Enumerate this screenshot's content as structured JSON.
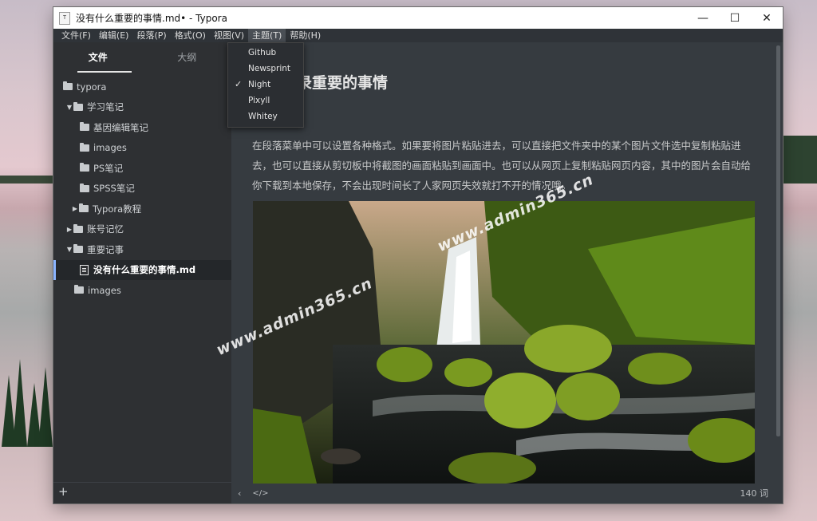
{
  "window": {
    "title": "没有什么重要的事情.md• - Typora",
    "app_icon_text": "T",
    "controls": {
      "minimize": "—",
      "maximize": "☐",
      "close": "✕"
    }
  },
  "menubar": {
    "items": [
      "文件(F)",
      "编辑(E)",
      "段落(P)",
      "格式(O)",
      "视图(V)",
      "主题(T)",
      "帮助(H)"
    ]
  },
  "theme_menu": {
    "items": [
      "Github",
      "Newsprint",
      "Night",
      "Pixyll",
      "Whitey"
    ],
    "checked": "Night",
    "check_glyph": "✓"
  },
  "sidebar": {
    "tabs": [
      "文件",
      "大纲"
    ],
    "active_tab": "文件",
    "tree": [
      {
        "label": "typora",
        "type": "folder",
        "caret": ""
      },
      {
        "label": "学习笔记",
        "type": "folder",
        "caret": "▼"
      },
      {
        "label": "基因编辑笔记",
        "type": "folder",
        "caret": ""
      },
      {
        "label": "images",
        "type": "folder",
        "caret": ""
      },
      {
        "label": "PS笔记",
        "type": "folder",
        "caret": ""
      },
      {
        "label": "SPSS笔记",
        "type": "folder",
        "caret": ""
      },
      {
        "label": "Typora教程",
        "type": "folder",
        "caret": "▶"
      },
      {
        "label": "账号记忆",
        "type": "folder",
        "caret": "▶"
      },
      {
        "label": "重要记事",
        "type": "folder",
        "caret": "▼"
      },
      {
        "label": "没有什么重要的事情.md",
        "type": "file",
        "caret": "",
        "active": true
      },
      {
        "label": "images",
        "type": "folder",
        "caret": ""
      }
    ],
    "add_label": "+"
  },
  "document": {
    "heading_visible": "录重要的事情",
    "paragraph": "在段落菜单中可以设置各种格式。如果要将图片粘贴进去，可以直接把文件夹中的某个图片文件选中复制粘贴进去，也可以直接从剪切板中将截图的画面粘贴到画面中。也可以从网页上复制粘贴网页内容，其中的图片会自动给你下载到本地保存，不会出现时间长了人家网页失效就打不开的情况哦。"
  },
  "statusbar": {
    "back": "‹",
    "source": "</>",
    "word_count": "140 词"
  },
  "watermarks": [
    "www.admin365.cn",
    "www.admin365.cn"
  ],
  "colors": {
    "editor_bg": "#363b40",
    "sidebar_bg": "#2e3033",
    "accent": "#8ab4ff"
  }
}
